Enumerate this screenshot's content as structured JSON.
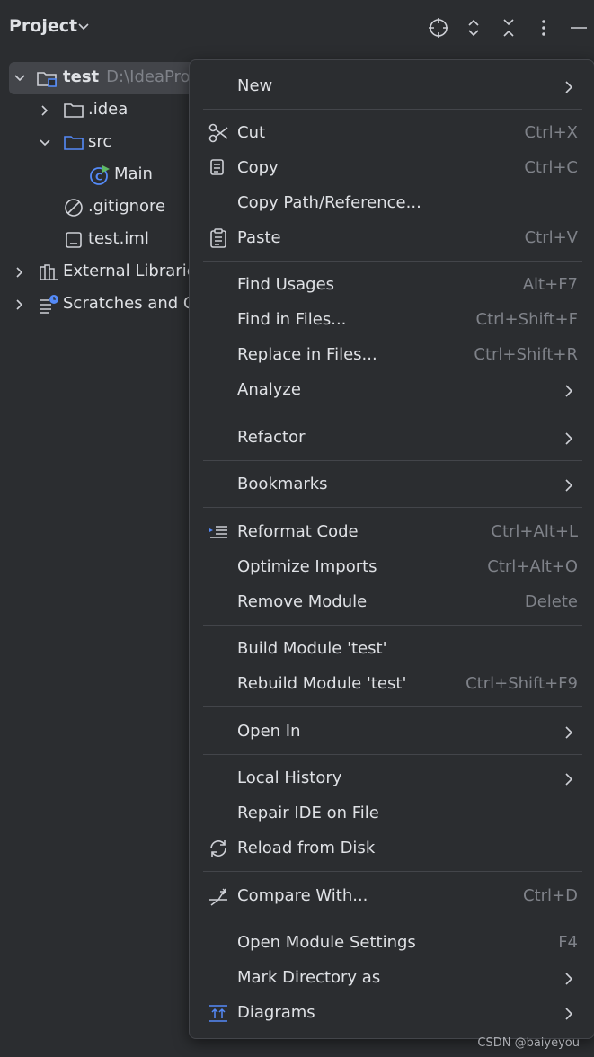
{
  "header": {
    "title": "Project",
    "icons": [
      "chevron-down-icon",
      "locate-icon",
      "expand-collapse-icon",
      "collapse-all-icon",
      "more-vertical-icon",
      "minimize-icon"
    ]
  },
  "tree": {
    "root": {
      "label": "test",
      "path": "D:\\IdeaPro"
    },
    "idea": ".idea",
    "src": "src",
    "main": "Main",
    "gitignore": ".gitignore",
    "iml": "test.iml",
    "external": "External Librarie",
    "scratches": "Scratches and C"
  },
  "menu": {
    "new": {
      "label": "New"
    },
    "cut": {
      "label": "Cut",
      "shortcut": "Ctrl+X"
    },
    "copy": {
      "label": "Copy",
      "shortcut": "Ctrl+C"
    },
    "copy_path": {
      "label": "Copy Path/Reference..."
    },
    "paste": {
      "label": "Paste",
      "shortcut": "Ctrl+V"
    },
    "find_usages": {
      "label": "Find Usages",
      "shortcut": "Alt+F7"
    },
    "find_in_files": {
      "label": "Find in Files...",
      "shortcut": "Ctrl+Shift+F"
    },
    "replace_in_files": {
      "label": "Replace in Files...",
      "shortcut": "Ctrl+Shift+R"
    },
    "analyze": {
      "label": "Analyze"
    },
    "refactor": {
      "label": "Refactor"
    },
    "bookmarks": {
      "label": "Bookmarks"
    },
    "reformat": {
      "label": "Reformat Code",
      "shortcut": "Ctrl+Alt+L"
    },
    "optimize": {
      "label": "Optimize Imports",
      "shortcut": "Ctrl+Alt+O"
    },
    "remove_module": {
      "label": "Remove Module",
      "shortcut": "Delete"
    },
    "build_module": {
      "label": "Build Module 'test'"
    },
    "rebuild_module": {
      "label": "Rebuild Module 'test'",
      "shortcut": "Ctrl+Shift+F9"
    },
    "open_in": {
      "label": "Open In"
    },
    "local_history": {
      "label": "Local History"
    },
    "repair_ide": {
      "label": "Repair IDE on File"
    },
    "reload": {
      "label": "Reload from Disk"
    },
    "compare": {
      "label": "Compare With...",
      "shortcut": "Ctrl+D"
    },
    "module_settings": {
      "label": "Open Module Settings",
      "shortcut": "F4"
    },
    "mark_dir": {
      "label": "Mark Directory as"
    },
    "diagrams": {
      "label": "Diagrams"
    }
  },
  "watermark": "CSDN @baiyeyou",
  "colors": {
    "background": "#2b2d30",
    "selection": "#43454a",
    "accent": "#548af7",
    "text": "#dfe1e5",
    "muted": "#7f8289"
  }
}
